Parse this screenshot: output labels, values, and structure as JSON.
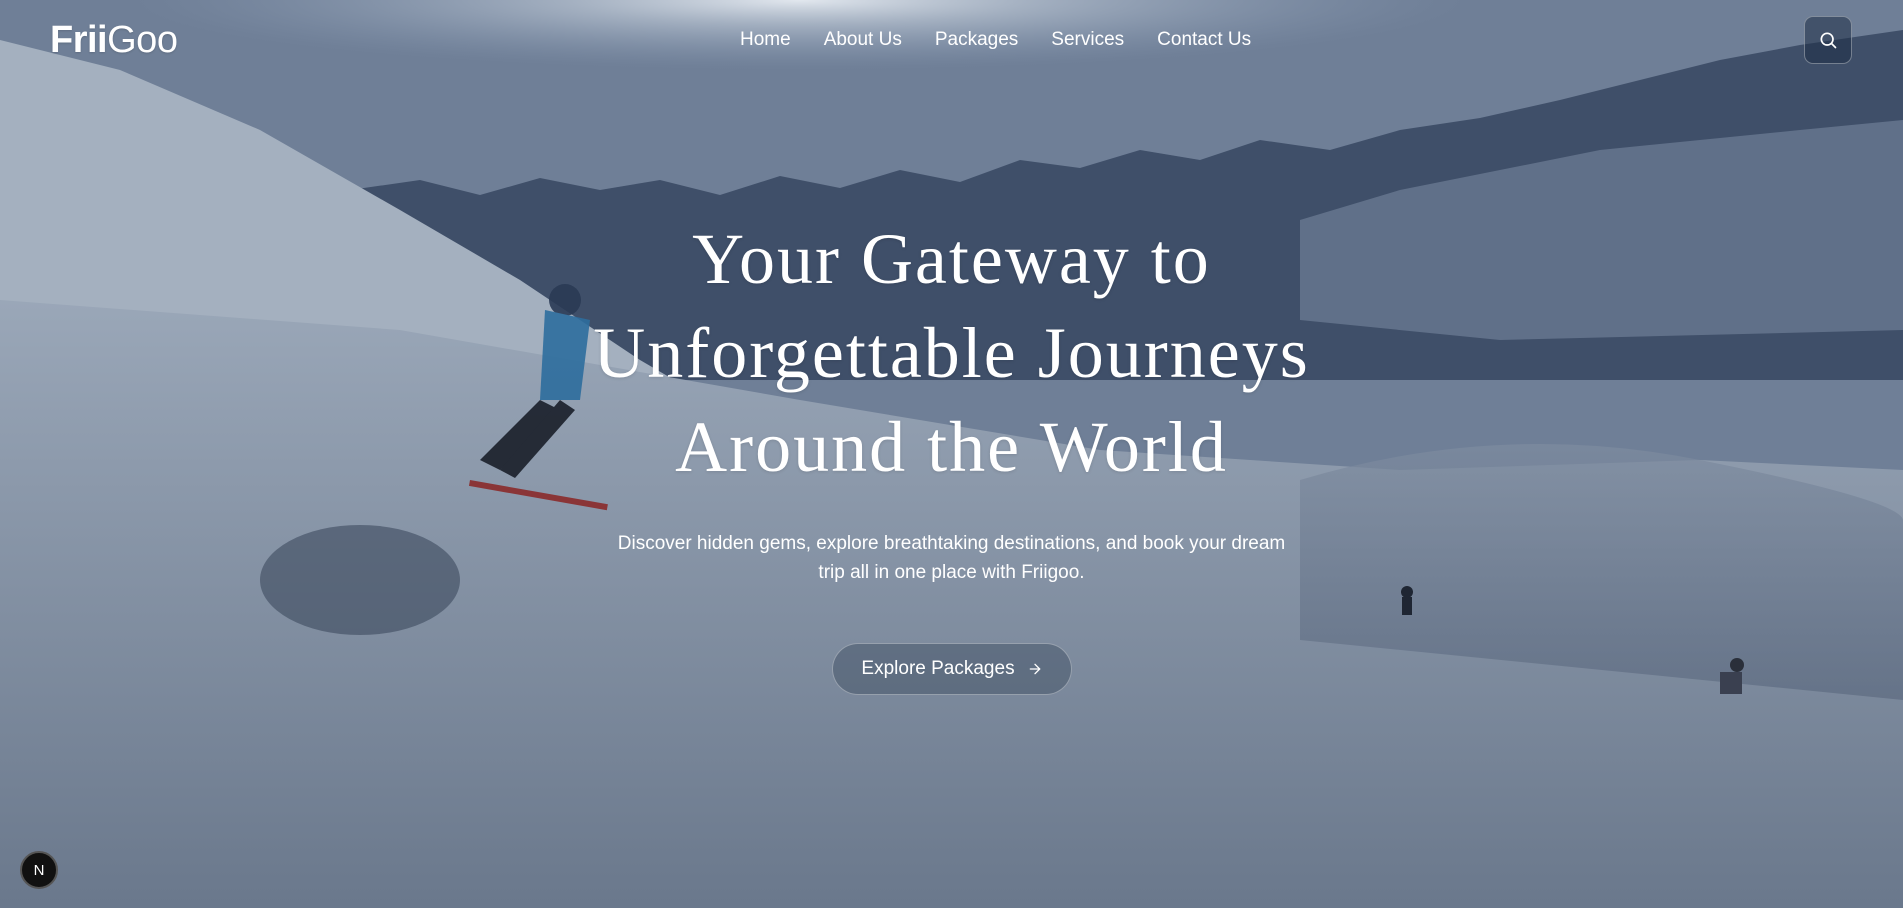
{
  "brand": {
    "logo_bold": "Frii",
    "logo_light": "Goo"
  },
  "nav": {
    "items": [
      {
        "label": "Home"
      },
      {
        "label": "About Us"
      },
      {
        "label": "Packages"
      },
      {
        "label": "Services"
      },
      {
        "label": "Contact Us"
      }
    ],
    "search_icon": "search-icon"
  },
  "hero": {
    "title_lines": [
      "Your Gateway to",
      "Unforgettable Journeys",
      "Around the World"
    ],
    "subtitle_lines": [
      "Discover hidden gems, explore breathtaking destinations, and book your dream",
      "trip all in one place with Friigoo."
    ],
    "cta_label": "Explore Packages",
    "cta_icon": "arrow-right-icon"
  },
  "dev_badge": {
    "letter": "N",
    "icon": "nextjs-icon"
  },
  "colors": {
    "text": "#ffffff",
    "sky": "#7b8aa1",
    "snow": "#8796ab",
    "mountain_shadow": "#3f4f69"
  }
}
